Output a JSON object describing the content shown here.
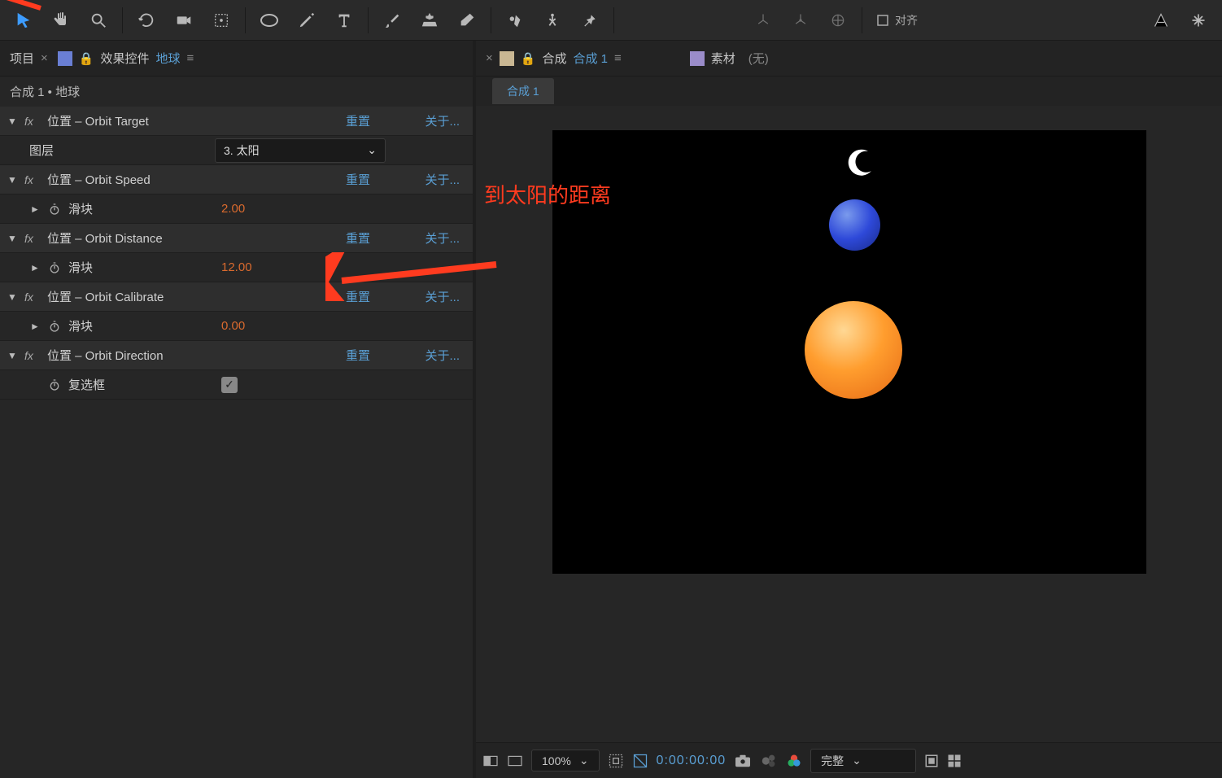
{
  "toolbar": {
    "align_label": "对齐"
  },
  "left_panel": {
    "tab1": "项目",
    "tab2_prefix": "效果控件",
    "tab2_link": "地球",
    "breadcrumb": "合成 1 • 地球"
  },
  "right_panel": {
    "tab_prefix": "合成",
    "tab_link": "合成 1",
    "material_label": "素材",
    "material_value": "(无)",
    "comp_tab": "合成 1"
  },
  "effects": [
    {
      "name": "位置 – Orbit Target",
      "reset": "重置",
      "about": "关于...",
      "type": "layer",
      "sub_label": "图层",
      "dropdown": "3. 太阳"
    },
    {
      "name": "位置 – Orbit Speed",
      "reset": "重置",
      "about": "关于...",
      "type": "slider",
      "sub_label": "滑块",
      "value": "2.00"
    },
    {
      "name": "位置 – Orbit Distance",
      "reset": "重置",
      "about": "关于...",
      "type": "slider",
      "sub_label": "滑块",
      "value": "12.00"
    },
    {
      "name": "位置 – Orbit Calibrate",
      "reset": "重置",
      "about": "关于...",
      "type": "slider",
      "sub_label": "滑块",
      "value": "0.00"
    },
    {
      "name": "位置 – Orbit Direction",
      "reset": "重置",
      "about": "关于...",
      "type": "checkbox",
      "sub_label": "复选框",
      "checked": true
    }
  ],
  "annotation": {
    "text": "到太阳的距离"
  },
  "footer": {
    "zoom": "100%",
    "timecode": "0:00:00:00",
    "quality": "完整"
  }
}
